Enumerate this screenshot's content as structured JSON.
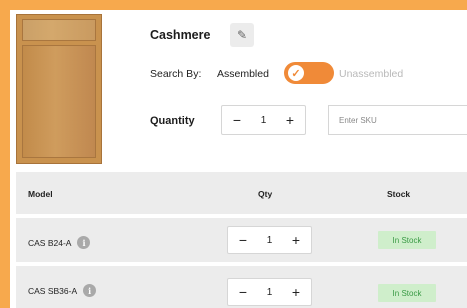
{
  "product": {
    "name": "Cashmere",
    "edit_icon": "pencil-icon"
  },
  "search": {
    "label": "Search By:",
    "option_assembled": "Assembled",
    "option_unassembled": "Unassembled",
    "selected": "Assembled",
    "toggle_color": "#f08a38"
  },
  "quantity": {
    "label": "Quantity",
    "value": "1",
    "minus": "−",
    "plus": "+"
  },
  "sku": {
    "placeholder": "Enter SKU",
    "value": ""
  },
  "table": {
    "headers": [
      "Model",
      "Qty",
      "Stock"
    ],
    "rows": [
      {
        "model": "CAS B24-A",
        "qty": "1",
        "stock": "In Stock"
      },
      {
        "model": "CAS SB36-A",
        "qty": "1",
        "stock": "In Stock"
      }
    ],
    "info_glyph": "i",
    "minus": "−",
    "plus": "+"
  },
  "colors": {
    "page_background": "#f7a94d",
    "in_stock_bg": "#cfeecb",
    "in_stock_text": "#3a9a45"
  }
}
